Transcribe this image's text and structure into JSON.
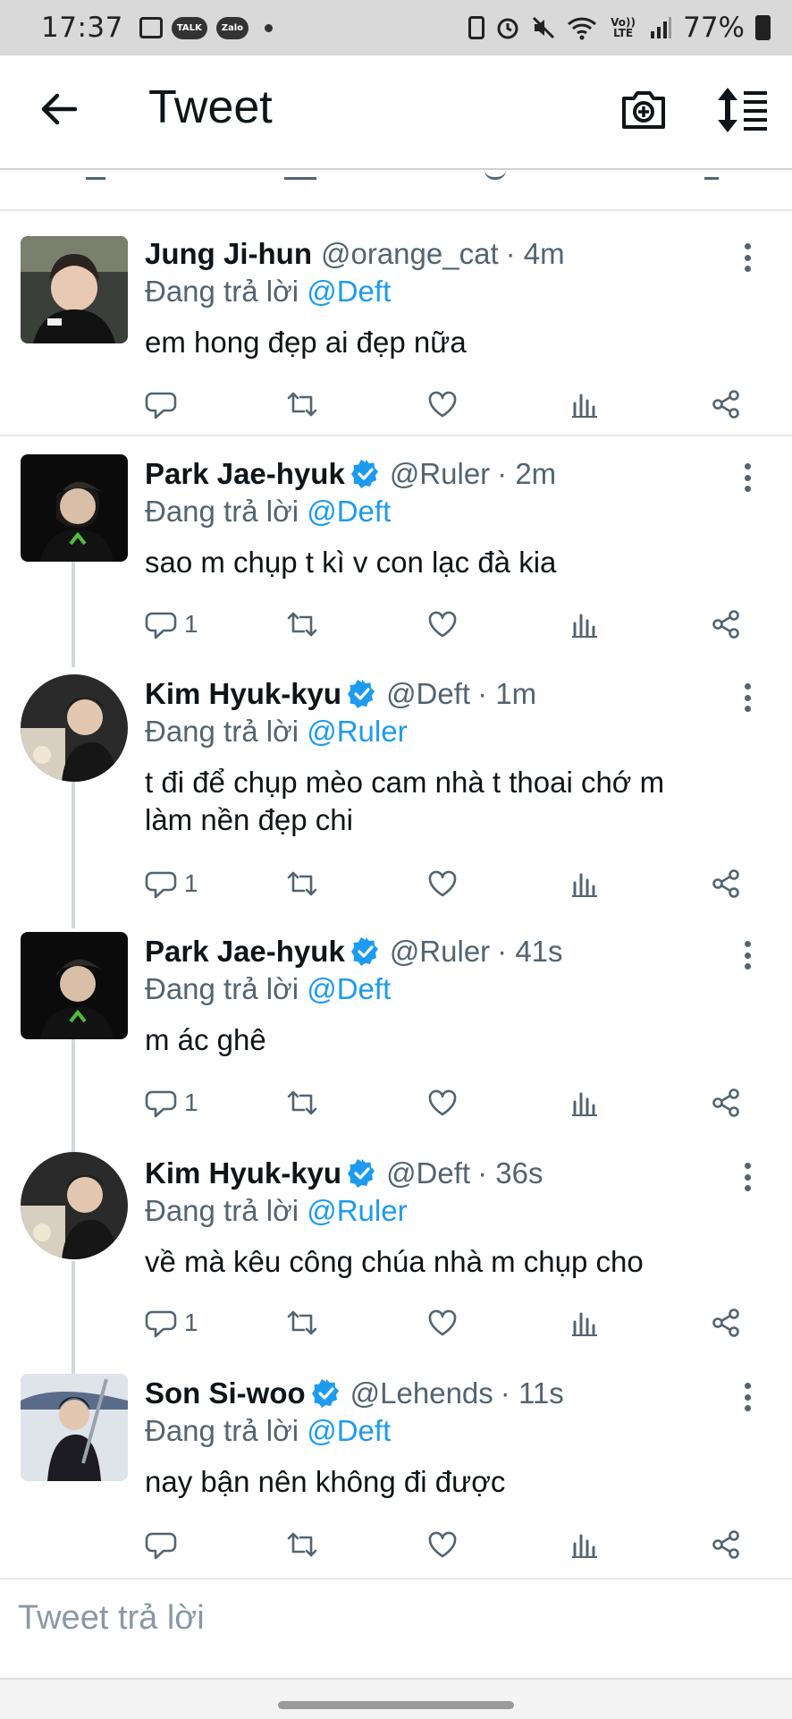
{
  "status_bar": {
    "time": "17:37",
    "app_labels": [
      "TALK",
      "Zalo"
    ],
    "network": "Vo)) LTE",
    "battery_percent": "77%"
  },
  "header": {
    "title": "Tweet",
    "icons": [
      "back-arrow-icon",
      "camera-plus-icon",
      "sort-icon"
    ]
  },
  "reply_prefix": "Đang trả lời",
  "tweets": [
    {
      "name": "Jung Ji-hun",
      "verified": false,
      "handle": "@orange_cat",
      "time": "· 4m",
      "reply_to": "@Deft",
      "text": "em hong đẹp ai đẹp nữa",
      "reply_count": ""
    },
    {
      "name": "Park Jae-hyuk",
      "verified": true,
      "handle": "@Ruler",
      "time": "· 2m",
      "reply_to": "@Deft",
      "text": "sao m chụp t kì v con lạc đà kia",
      "reply_count": "1"
    },
    {
      "name": "Kim Hyuk-kyu",
      "verified": true,
      "handle": "@Deft",
      "time": "· 1m",
      "reply_to": "@Ruler",
      "text_lines": [
        "t đi để chụp mèo cam nhà t thoai chớ m",
        "làm nền đẹp chi"
      ],
      "reply_count": "1"
    },
    {
      "name": "Park Jae-hyuk",
      "verified": true,
      "handle": "@Ruler",
      "time": "· 41s",
      "reply_to": "@Deft",
      "text": "m ác ghê",
      "reply_count": "1"
    },
    {
      "name": "Kim Hyuk-kyu",
      "verified": true,
      "handle": "@Deft",
      "time": "· 36s",
      "reply_to": "@Ruler",
      "text": "về mà kêu công chúa nhà m chụp cho",
      "reply_count": "1"
    },
    {
      "name": "Son Si-woo",
      "verified": true,
      "handle": "@Lehends",
      "time": "· 11s",
      "reply_to": "@Deft",
      "text": "nay bận nên không đi được",
      "reply_count": ""
    }
  ],
  "reply_box": {
    "placeholder": "Tweet trả lời"
  },
  "colors": {
    "accent": "#1d9bf0",
    "muted": "#536471",
    "text": "#0f1419"
  }
}
